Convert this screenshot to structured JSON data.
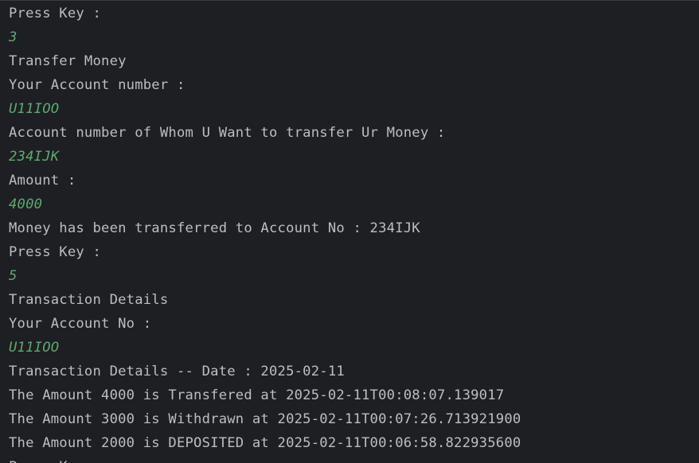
{
  "console": {
    "lines": [
      {
        "text": "Press Key :",
        "kind": "output"
      },
      {
        "text": "3",
        "kind": "input"
      },
      {
        "text": "Transfer Money",
        "kind": "output"
      },
      {
        "text": "Your Account number :",
        "kind": "output"
      },
      {
        "text": "U11IOO",
        "kind": "input"
      },
      {
        "text": "Account number of Whom U Want to transfer Ur Money :",
        "kind": "output"
      },
      {
        "text": "234IJK",
        "kind": "input"
      },
      {
        "text": "Amount :",
        "kind": "output"
      },
      {
        "text": "4000",
        "kind": "input"
      },
      {
        "text": "Money has been transferred to Account No : 234IJK",
        "kind": "output"
      },
      {
        "text": "Press Key :",
        "kind": "output"
      },
      {
        "text": "5",
        "kind": "input"
      },
      {
        "text": "Transaction Details",
        "kind": "output"
      },
      {
        "text": "Your Account No :",
        "kind": "output"
      },
      {
        "text": "U11IOO",
        "kind": "input"
      },
      {
        "text": "Transaction Details -- Date : 2025-02-11",
        "kind": "output"
      },
      {
        "text": "The Amount 4000 is Transfered at 2025-02-11T00:08:07.139017",
        "kind": "output"
      },
      {
        "text": "The Amount 3000 is Withdrawn at 2025-02-11T00:07:26.713921900",
        "kind": "output"
      },
      {
        "text": "The Amount 2000 is DEPOSITED at 2025-02-11T00:06:58.822935600",
        "kind": "output"
      },
      {
        "text": "Press Key :",
        "kind": "output"
      }
    ]
  },
  "colors": {
    "background": "#1e1f22",
    "output_text": "#bcbec4",
    "input_text": "#5aab73"
  }
}
